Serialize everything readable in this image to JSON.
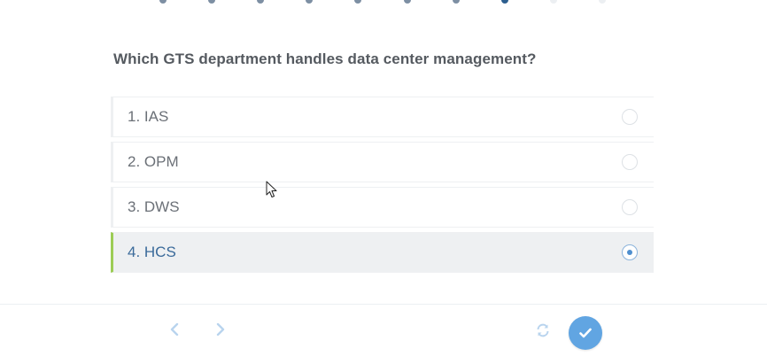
{
  "progress": {
    "total": 10,
    "current_index": 8
  },
  "question": {
    "text": "Which GTS department handles data center management?"
  },
  "options": [
    {
      "label": "1. IAS",
      "selected": false
    },
    {
      "label": "2. OPM",
      "selected": false
    },
    {
      "label": "3. DWS",
      "selected": false
    },
    {
      "label": "4. HCS",
      "selected": true
    }
  ],
  "footer": {
    "prev_icon": "chevron-left-icon",
    "next_icon": "chevron-right-icon",
    "refresh_icon": "refresh-icon",
    "submit_icon": "check-icon"
  },
  "colors": {
    "selected_accent": "#9ccc55",
    "selected_text": "#3a6a9a",
    "submit_button": "#61a5e2",
    "nav_icon": "#b9d4ee",
    "progress_done": "#7d8fa3",
    "progress_current": "#2d5f8f"
  }
}
